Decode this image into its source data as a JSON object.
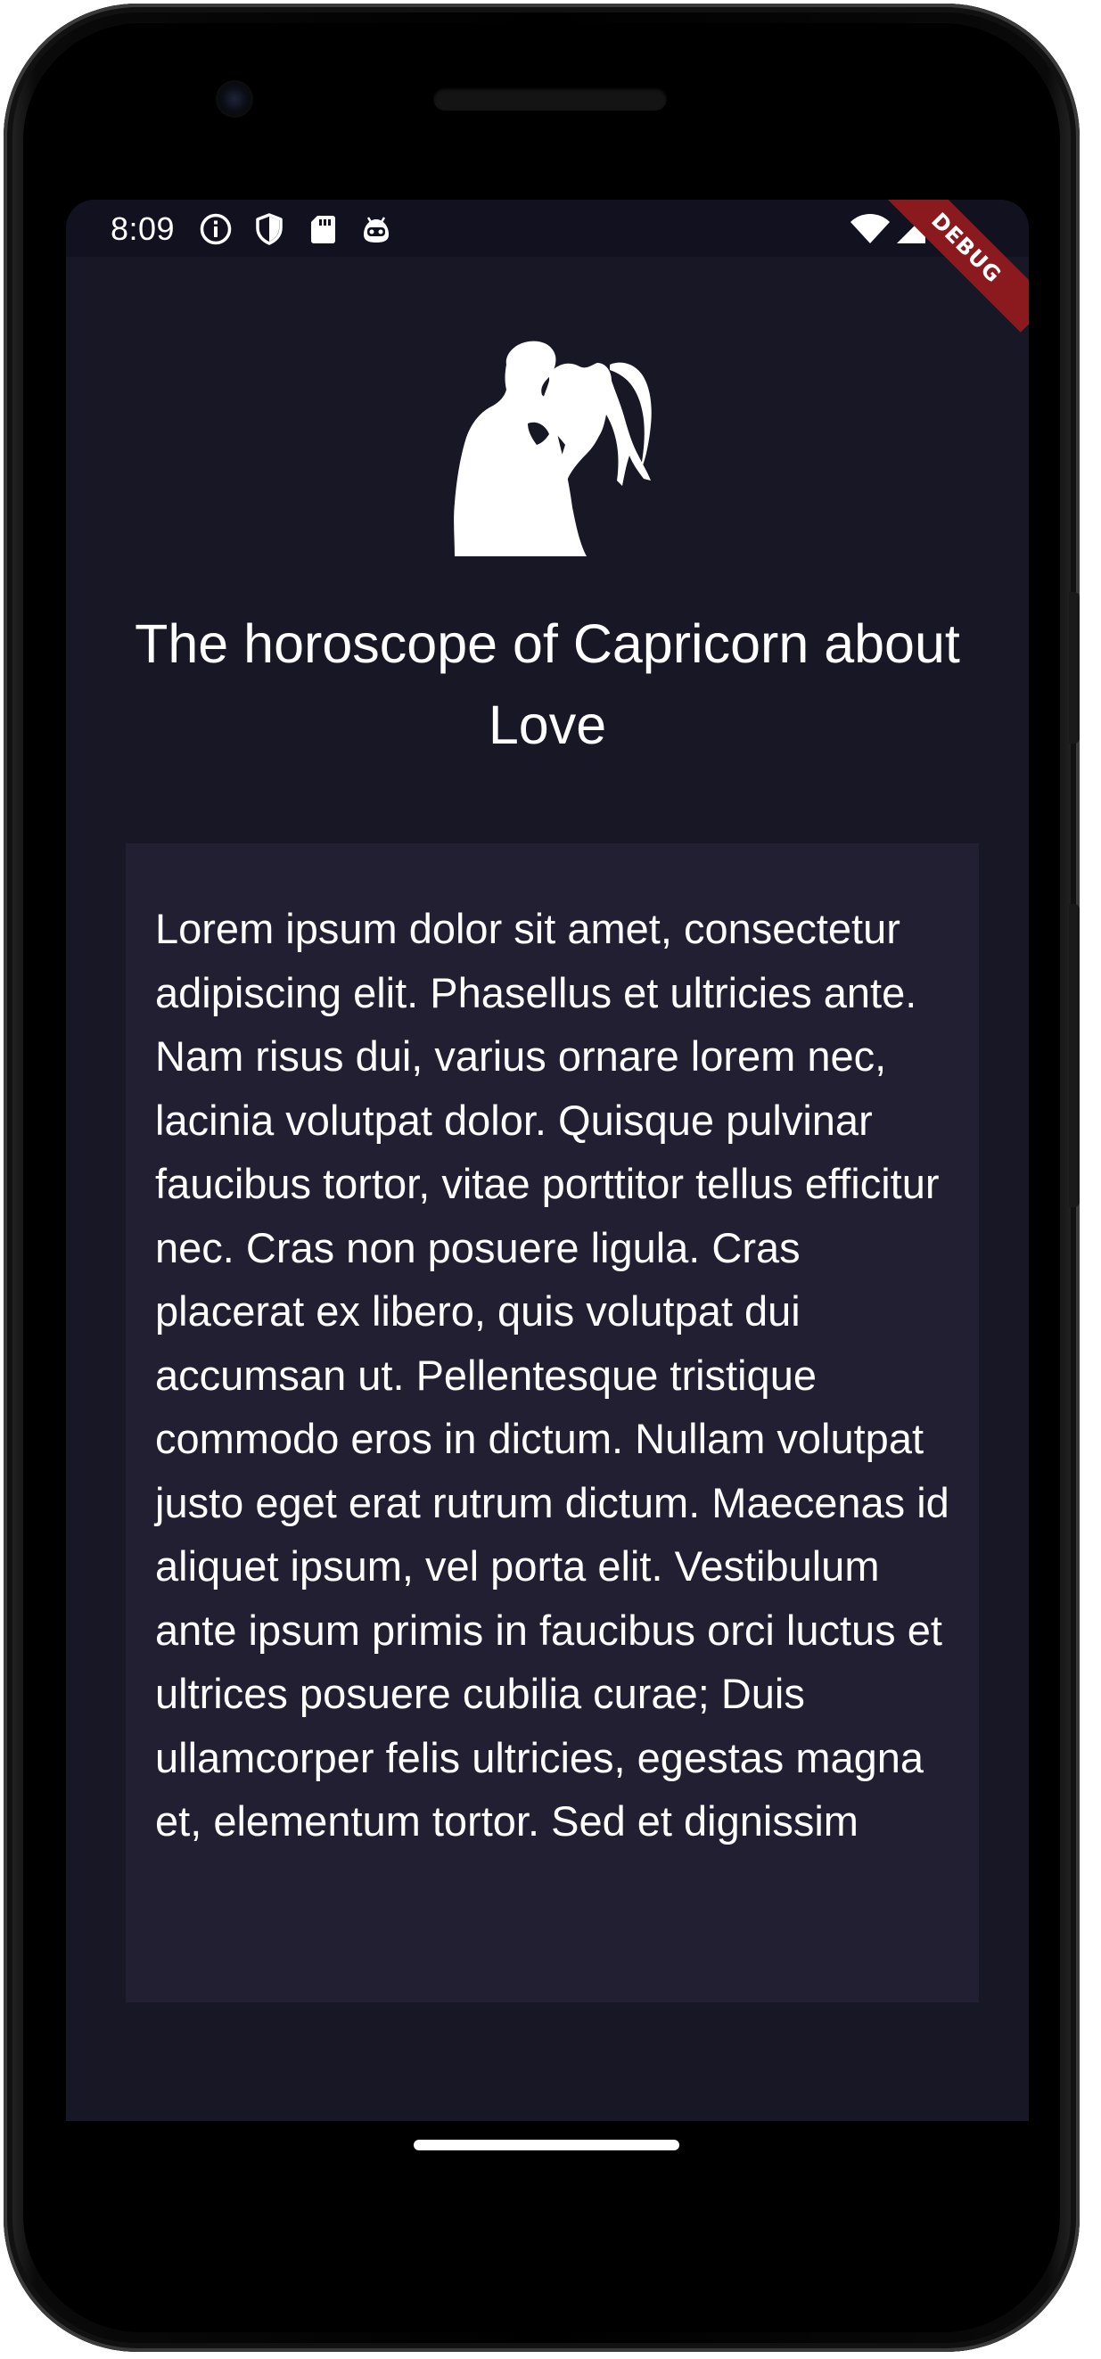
{
  "status_bar": {
    "time": "8:09",
    "left_icons": [
      "info-icon",
      "shield-icon",
      "sd-card-icon",
      "robot-icon"
    ],
    "right_icons": [
      "wifi-icon",
      "cellular-signal-icon"
    ],
    "debug_label": "DEBUG"
  },
  "hero": {
    "image": "couple-silhouette-icon"
  },
  "title": "The horoscope of Capricorn about Love",
  "content": {
    "text": "Lorem ipsum dolor sit amet, consectetur adipiscing elit. Phasellus et ultricies ante. Nam risus dui, varius ornare lorem nec, lacinia volutpat dolor. Quisque pulvinar faucibus tortor, vitae porttitor tellus efficitur nec. Cras non posuere ligula. Cras placerat ex libero, quis volutpat dui accumsan ut. Pellentesque tristique commodo eros in dictum. Nullam volutpat justo eget erat rutrum dictum. Maecenas id aliquet ipsum, vel porta elit. Vestibulum ante ipsum primis in faucibus orci luctus et ultrices posuere cubilia curae; Duis ullamcorper felis ultricies, egestas magna et, elementum tortor. Sed et dignissim"
  },
  "colors": {
    "screen_background": "#181726",
    "card_background": "#211f31",
    "status_bar_background": "#121120",
    "debug_banner": "#8a1a1d",
    "text": "#ffffff"
  }
}
